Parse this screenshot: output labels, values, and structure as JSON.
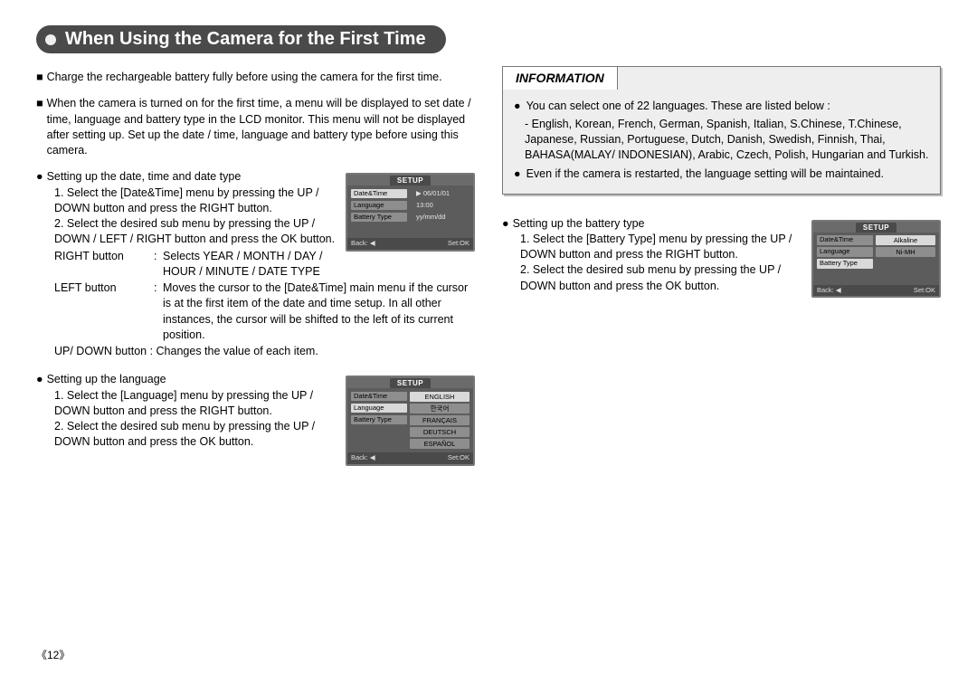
{
  "title": "When Using the Camera for the First Time",
  "para1": "Charge the rechargeable battery fully before using the camera for the first time.",
  "para2": "When the camera is turned on for the first time, a menu will be displayed to set date / time, language and battery type in the LCD monitor. This menu will not be displayed after setting up. Set up the date / time, language and battery type before using this camera.",
  "dateSection": {
    "heading": "Setting up the date, time and date type",
    "step1": "1. Select the [Date&Time] menu by pressing the UP / DOWN button and press the RIGHT button.",
    "step2": "2. Select the desired sub menu by pressing the UP / DOWN / LEFT / RIGHT button and press the OK button.",
    "rightLabel": "RIGHT button",
    "rightText": "Selects YEAR / MONTH / DAY / HOUR / MINUTE / DATE TYPE",
    "leftLabel": "LEFT button",
    "leftText": "Moves the cursor to the [Date&Time] main menu if the cursor is at the first item of the date and time setup. In all other instances, the cursor will be shifted to the left of its current position.",
    "updownText": "UP/ DOWN button : Changes the value of each item."
  },
  "langSection": {
    "heading": "Setting up the language",
    "step1": "1. Select the [Language] menu by pressing the UP / DOWN button and press the RIGHT button.",
    "step2": "2. Select the desired sub menu by pressing the UP / DOWN button and press the OK button."
  },
  "info": {
    "heading": "INFORMATION",
    "p1": "You can select one of 22 languages. These are listed below :",
    "p1sub": "- English, Korean, French, German, Spanish, Italian, S.Chinese, T.Chinese, Japanese, Russian, Portuguese, Dutch, Danish, Swedish, Finnish, Thai, BAHASA(MALAY/ INDONESIAN), Arabic, Czech, Polish, Hungarian and Turkish.",
    "p2": "Even if the camera is restarted, the language setting will be maintained."
  },
  "battSection": {
    "heading": "Setting up the battery type",
    "step1": "1. Select the [Battery Type] menu by pressing the UP / DOWN button and press the RIGHT button.",
    "step2": "2. Select the desired sub menu by pressing the UP / DOWN button and press the OK button."
  },
  "lcd": {
    "setup": "SETUP",
    "back": "Back:",
    "set": "Set:OK",
    "row1": "Date&Time",
    "row2": "Language",
    "row3": "Battery Type",
    "date1": "06/01/01",
    "date2": "13:00",
    "date3": "yy/mm/dd",
    "lang1": "ENGLISH",
    "lang2": "한국어",
    "lang3": "FRANÇAIS",
    "lang4": "DEUTSCH",
    "lang5": "ESPAÑOL",
    "bat1": "Alkaline",
    "bat2": "Ni-MH"
  },
  "pageNumber": "《12》",
  "colon": ":"
}
